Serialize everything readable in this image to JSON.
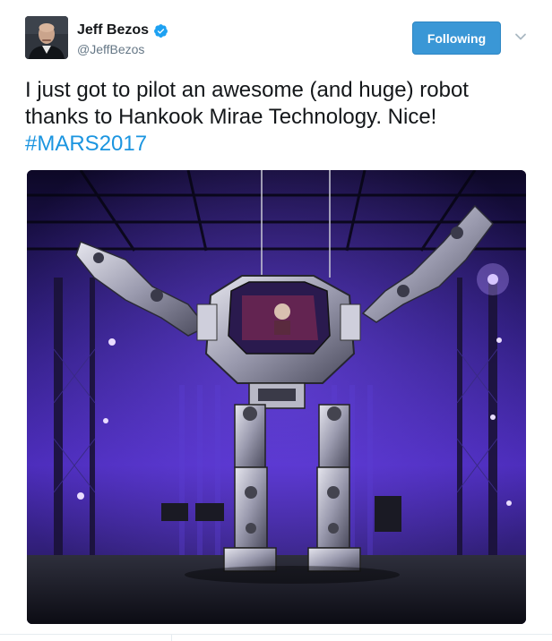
{
  "tweet": {
    "author": {
      "display_name": "Jeff Bezos",
      "handle": "@JeffBezos",
      "verified": true,
      "avatar_icon": "profile-photo"
    },
    "follow_button_label": "Following",
    "text_main": "I just got to pilot an awesome (and huge) robot thanks to Hankook Mirae Technology. Nice!",
    "hashtag": "#MARS2017",
    "media": {
      "type": "photo"
    }
  },
  "colors": {
    "brand_blue": "#1da1f2",
    "follow_button": "#3a97d6",
    "hashtag": "#1b95e0",
    "handle_gray": "#657786"
  },
  "icons": {
    "verified": "verified-badge-icon",
    "caret": "chevron-down-icon"
  }
}
